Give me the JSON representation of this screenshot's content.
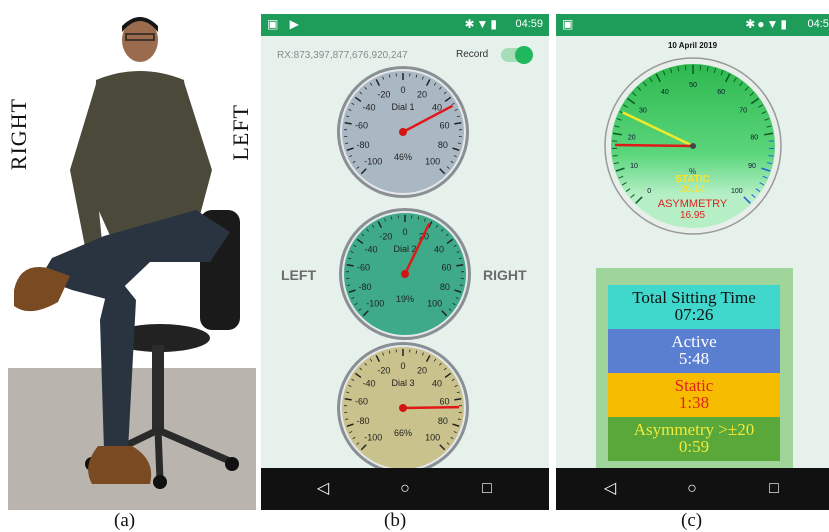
{
  "panel_a": {
    "label_right": "RIGHT",
    "label_left": "LEFT",
    "caption": "(a)"
  },
  "panel_b": {
    "caption": "(b)",
    "status_time": "04:59",
    "rx_text": "RX:873,397,877,676,920,247",
    "record_label": "Record",
    "record_on": true,
    "side_left": "LEFT",
    "side_right": "RIGHT",
    "dials": [
      {
        "title": "Dial 1",
        "percent": "46%",
        "value": 46,
        "face": "#aab8c4",
        "ticks": [
          "-20",
          "0",
          "20",
          "-40",
          "40",
          "-60",
          "60",
          "-80",
          "80",
          "-100",
          "100"
        ]
      },
      {
        "title": "Dial 2",
        "percent": "19%",
        "value": 19,
        "face": "#3faa88",
        "ticks": [
          "-20",
          "0",
          "20",
          "-40",
          "40",
          "-60",
          "60",
          "-80",
          "80",
          "-100",
          "100"
        ]
      },
      {
        "title": "Dial 3",
        "percent": "66%",
        "value": 66,
        "face": "#c9c28c",
        "ticks": [
          "-20",
          "0",
          "20",
          "-40",
          "40",
          "-60",
          "60",
          "-80",
          "80",
          "-100",
          "100"
        ]
      }
    ]
  },
  "panel_c": {
    "caption": "(c)",
    "status_time": "04:59",
    "date": "10 April 2019",
    "gauge_ticks": [
      "10",
      "20",
      "30",
      "40",
      "50",
      "60",
      "70",
      "80",
      "90",
      "100",
      "0"
    ],
    "percent_sign": "%",
    "static_label": "STATIC",
    "static_value": "26.14",
    "asym_label": "ASYMMETRY",
    "asym_value": "16.95",
    "summary": [
      {
        "label": "Total Sitting Time",
        "value": "07:26",
        "bg": "#40d7cd",
        "fg": "#111111"
      },
      {
        "label": "Active",
        "value": "5:48",
        "bg": "#5b7fd0",
        "fg": "#ffffff"
      },
      {
        "label": "Static",
        "value": "1:38",
        "bg": "#f6bd00",
        "fg": "#e02020"
      },
      {
        "label": "Asymmetry >±20",
        "value": "0:59",
        "bg": "#5aa83a",
        "fg": "#f0ea3a"
      }
    ]
  },
  "colors": {
    "status_green": "#1e9c5a",
    "needle_red": "#e01818"
  }
}
